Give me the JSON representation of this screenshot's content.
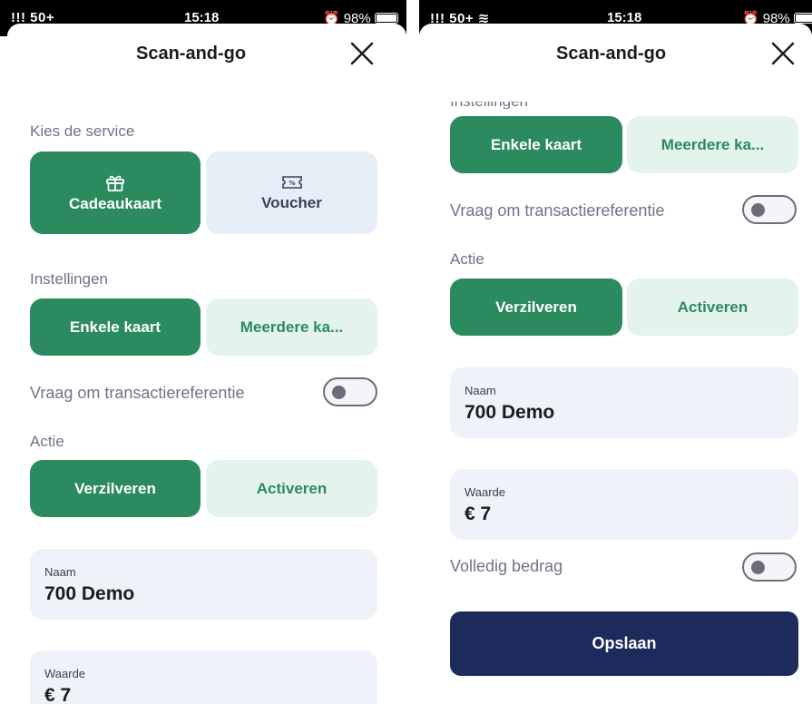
{
  "status_bar": {
    "signal": "!!! 50+",
    "time": "15:18",
    "battery": "98%"
  },
  "title": "Scan-and-go",
  "service": {
    "label": "Kies de service",
    "options": [
      {
        "label": "Cadeaukaart",
        "icon": "gift-icon",
        "selected": true
      },
      {
        "label": "Voucher",
        "icon": "voucher-icon",
        "selected": false
      }
    ]
  },
  "settings": {
    "label": "Instellingen",
    "options": [
      {
        "label": "Enkele kaart",
        "selected": true
      },
      {
        "label": "Meerdere ka...",
        "selected": false
      }
    ]
  },
  "transaction_ref": {
    "label": "Vraag om transactiereferentie",
    "enabled": false
  },
  "action": {
    "label": "Actie",
    "options": [
      {
        "label": "Verzilveren",
        "selected": true
      },
      {
        "label": "Activeren",
        "selected": false
      }
    ]
  },
  "fields": {
    "name": {
      "label": "Naam",
      "value": "700 Demo"
    },
    "value": {
      "label": "Waarde",
      "value": "€ 7"
    }
  },
  "full_amount": {
    "label": "Volledig bedrag",
    "enabled": false
  },
  "save_label": "Opslaan",
  "colors": {
    "green": "#2b8a5e",
    "mint": "#e4f4ec",
    "navy": "#1c2b5b",
    "field": "#eff2f8"
  }
}
